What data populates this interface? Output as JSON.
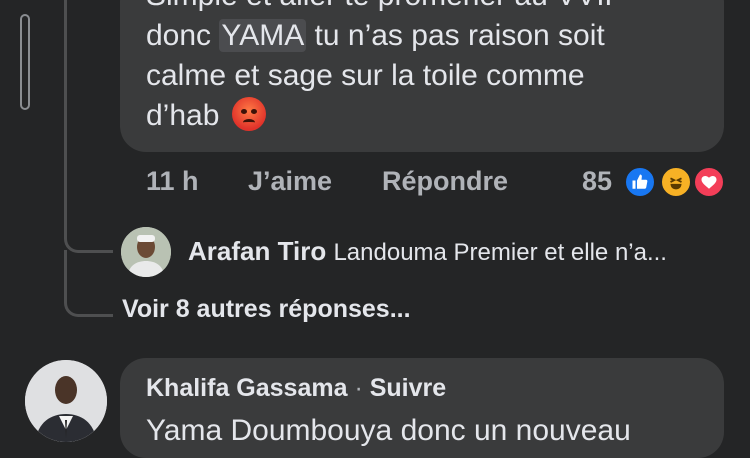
{
  "comment": {
    "lines": [
      "Simple et aller te promener au VVIP",
      "donc",
      "YAMA",
      "tu n’as pas raison soit",
      "calme et sage sur la toile comme",
      "d’hab"
    ],
    "emoji": "angry-face-emoji"
  },
  "actions": {
    "time": "11 h",
    "like": "J’aime",
    "reply": "Répondre"
  },
  "reactions": {
    "count": "85",
    "types": [
      "like-icon",
      "haha-icon",
      "love-icon"
    ],
    "colors": {
      "like": "#1877f2",
      "haha": "#f7b125",
      "love": "#f33e58"
    }
  },
  "reply_preview": {
    "author": "Arafan Tiro",
    "snippet": "Landouma Premier et elle n’a..."
  },
  "more_replies": "Voir 8 autres réponses...",
  "comment2": {
    "author": "Khalifa Gassama",
    "separator": "·",
    "follow": "Suivre",
    "text": "Yama Doumbouya donc un nouveau"
  }
}
